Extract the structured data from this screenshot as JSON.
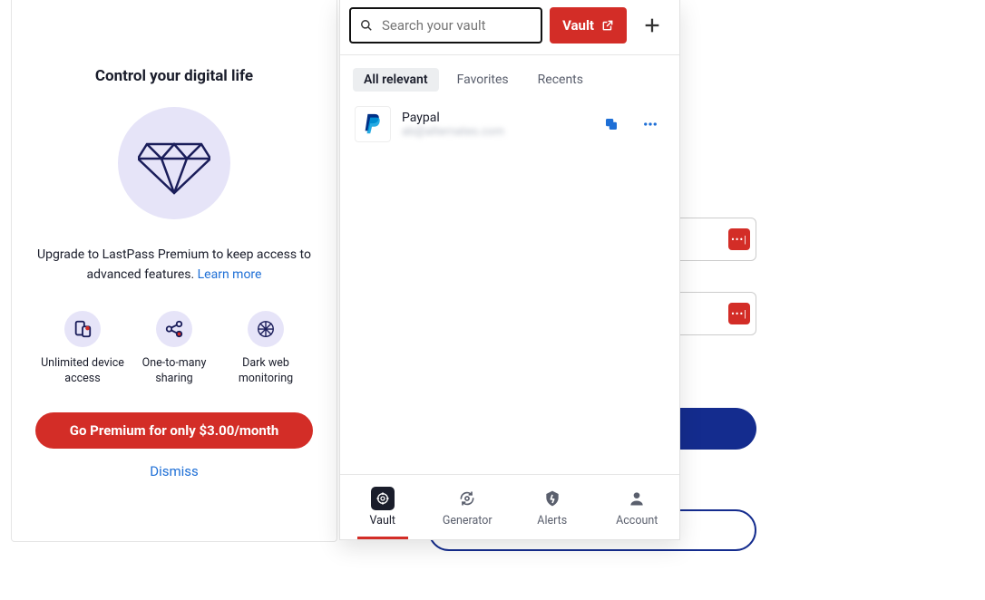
{
  "promo": {
    "title": "Control your digital life",
    "subtext_prefix": "Upgrade to LastPass Premium to keep access to advanced features. ",
    "learn_more": "Learn more",
    "features": [
      {
        "label": "Unlimited device access"
      },
      {
        "label": "One-to-many sharing"
      },
      {
        "label": "Dark web monitoring"
      }
    ],
    "cta": "Go Premium for only $3.00/month",
    "dismiss": "Dismiss"
  },
  "ext": {
    "search_placeholder": "Search your vault",
    "vault_button": "Vault",
    "tabs": {
      "all": "All relevant",
      "fav": "Favorites",
      "recent": "Recents"
    },
    "entry": {
      "title": "Paypal",
      "subtitle": "ab@alternates.com"
    },
    "nav": {
      "vault": "Vault",
      "generator": "Generator",
      "alerts": "Alerts",
      "account": "Account"
    }
  },
  "chip": "•••|"
}
